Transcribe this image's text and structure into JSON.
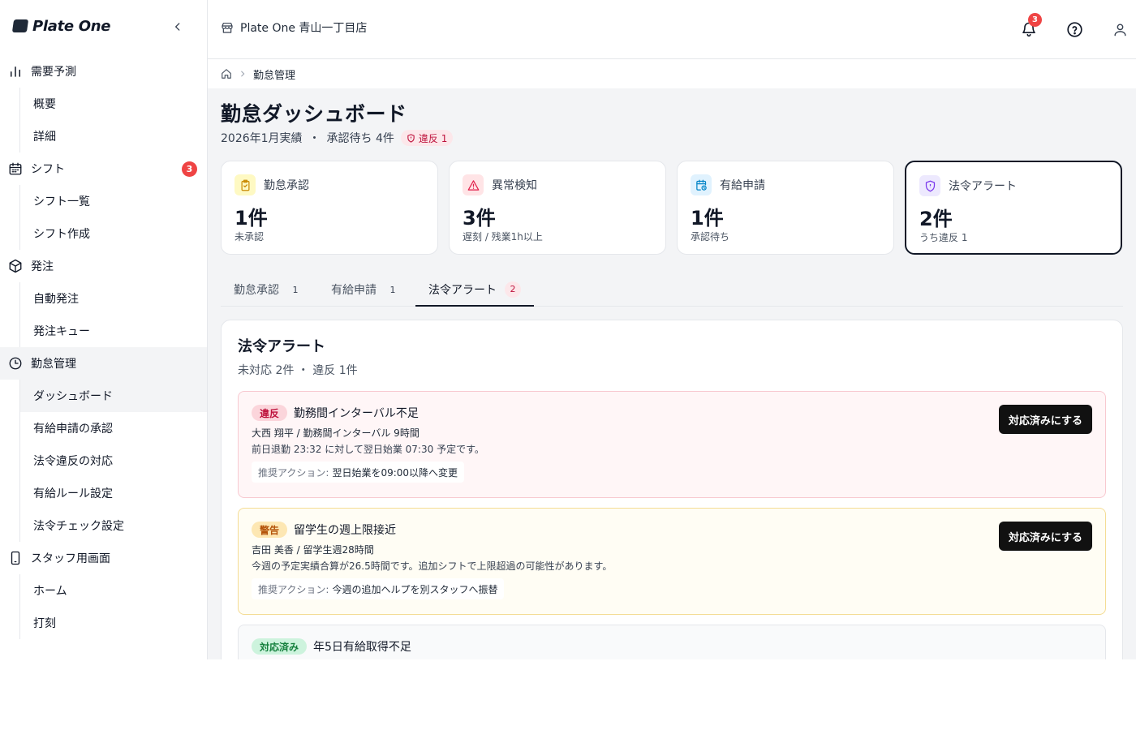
{
  "brand": {
    "name": "Plate One"
  },
  "header": {
    "store_name": "Plate One 青山一丁目店",
    "notification_count": "3"
  },
  "sidebar": {
    "groups": [
      {
        "label": "需要予測",
        "icon": "bar-chart-icon",
        "items": [
          "概要",
          "詳細"
        ]
      },
      {
        "label": "シフト",
        "icon": "calendar-icon",
        "badge": "3",
        "items": [
          "シフト一覧",
          "シフト作成"
        ]
      },
      {
        "label": "発注",
        "icon": "box-icon",
        "items": [
          "自動発注",
          "発注キュー"
        ]
      },
      {
        "label": "勤怠管理",
        "icon": "clock-icon",
        "active": true,
        "items": [
          "ダッシュボード",
          "有給申請の承認",
          "法令違反の対応",
          "有給ルール設定",
          "法令チェック設定"
        ]
      },
      {
        "label": "スタッフ用画面",
        "icon": "smartphone-icon",
        "items": [
          "ホーム",
          "打刻"
        ]
      }
    ]
  },
  "breadcrumb": {
    "current": "勤怠管理"
  },
  "page": {
    "title": "勤怠ダッシュボード",
    "period": "2026年1月実績",
    "separator": "・",
    "pending": "承認待ち 4件",
    "violation_badge": "違反 1"
  },
  "stats": [
    {
      "label": "勤怠承認",
      "value": "1件",
      "sub": "未承認",
      "color": "#ca8a04",
      "bg": "#fef9c3",
      "icon": "clipboard-check-icon"
    },
    {
      "label": "異常検知",
      "value": "3件",
      "sub": "遅刻 / 残業1h以上",
      "color": "#e11d48",
      "bg": "#ffe4e6",
      "icon": "warning-triangle-icon"
    },
    {
      "label": "有給申請",
      "value": "1件",
      "sub": "承認待ち",
      "color": "#0284c7",
      "bg": "#e0f2fe",
      "icon": "calendar-clock-icon"
    },
    {
      "label": "法令アラート",
      "value": "2件",
      "sub": "うち違反 1",
      "color": "#7c3aed",
      "bg": "#ede9fe",
      "icon": "shield-alert-icon"
    }
  ],
  "tabs": [
    {
      "label": "勤怠承認",
      "count": "1"
    },
    {
      "label": "有給申請",
      "count": "1"
    },
    {
      "label": "法令アラート",
      "count": "2",
      "active": true
    }
  ],
  "panel": {
    "title": "法令アラート",
    "summary": "未対応 2件 ・ 違反 1件",
    "alerts": [
      {
        "level": "違反",
        "title": "勤務間インターバル不足",
        "detail": "大西 翔平 / 勤務間インターバル 9時間",
        "description": "前日退勤 23:32 に対して翌日始業 07:30 予定です。",
        "rec_label": "推奨アクション:",
        "rec_text": "翌日始業を09:00以降へ変更",
        "button": "対応済みにする"
      },
      {
        "level": "警告",
        "title": "留学生の週上限接近",
        "detail": "吉田 美香 / 留学生週28時間",
        "description": "今週の予定実績合算が26.5時間です。追加シフトで上限超過の可能性があります。",
        "rec_label": "推奨アクション:",
        "rec_text": "今週の追加ヘルプを別スタッフへ振替",
        "button": "対応済みにする"
      },
      {
        "level": "対応済み",
        "title": "年5日有給取得不足"
      }
    ]
  }
}
